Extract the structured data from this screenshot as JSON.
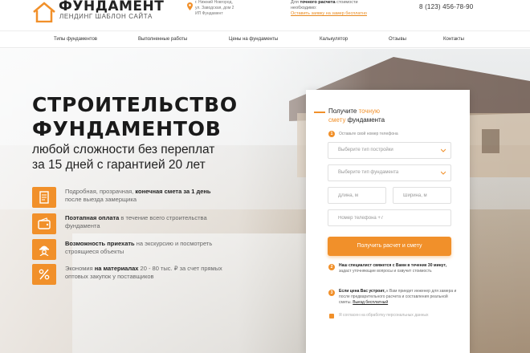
{
  "brand": {
    "title": "ФУНДАМЕНТ",
    "subtitle": "ЛЕНДИНГ ШАБЛОН САЙТА",
    "accent": "#f1902a"
  },
  "header": {
    "address_lines": [
      "г. Нижний Новгород,",
      "ул. Заводская, дом 2",
      "ИП Фундамент"
    ],
    "calc_note_prefix": "Для ",
    "calc_note_bold": "точного расчета",
    "calc_note_suffix": " стоимости",
    "calc_note_line2": "необходимо:",
    "calc_note_link": "Оставить заявку на замер бесплатно",
    "phone": "8 (123) 456-78-90"
  },
  "nav": {
    "items": [
      "Типы фундаментов",
      "Выполненные работы",
      "Цены на фундаменты",
      "Калькулятор",
      "Отзывы",
      "Контакты"
    ]
  },
  "hero": {
    "title_line1": "СТРОИТЕЛЬСТВО",
    "title_line2": "ФУНДАМЕНТОВ",
    "sub_line1": "любой сложности без переплат",
    "sub_line2": "за 15 дней с гарантией 20 лет",
    "features": [
      {
        "icon": "document-icon",
        "pre": "Подробная, прозрачная, ",
        "bold": "конечная смета за 1 день",
        "post": " после выезда замерщика"
      },
      {
        "icon": "wallet-icon",
        "pre": "",
        "bold": "Поэтапная оплата",
        "post": " в течение всего строительства фундамента"
      },
      {
        "icon": "worker-icon",
        "pre": "",
        "bold": "Возможность приехать",
        "post": " на экскурсию и посмотреть строящиеся объекты"
      },
      {
        "icon": "percent-icon",
        "pre": "Экономия ",
        "bold": "на материалах",
        "post": " 20 - 80 тыс. ₽ за счет прямых оптовых закупок у поставщиков"
      }
    ]
  },
  "form": {
    "title_pre": "Получите ",
    "title_hl1": "точную",
    "title_hl2": "смету",
    "title_post": " фундамента",
    "step1_hint": "Оставьте свой номер телефона",
    "building_type_placeholder": "Выберите тип постройки",
    "foundation_type_placeholder": "Выберите тип фундамента",
    "length_placeholder": "Длина, м",
    "width_placeholder": "Ширина, м",
    "phone_placeholder": "Номер телефона +7",
    "submit_label": "Получить расчет и смету",
    "step2_bold": "Наш специалист свяжется с Вами в течение 30 минут,",
    "step2_text": " задаст уточняющие вопросы и озвучит стоимость",
    "step3_bold": "Если цена Вас устроит,",
    "step3_text": " к Вам приедет инженер для замера и после предварительного расчета и составления реальной сметы. ",
    "step3_link": "Выезд бесплатный",
    "consent_text": "Я согласен на обработку персональных данных",
    "steps": [
      "1",
      "2",
      "3"
    ]
  }
}
